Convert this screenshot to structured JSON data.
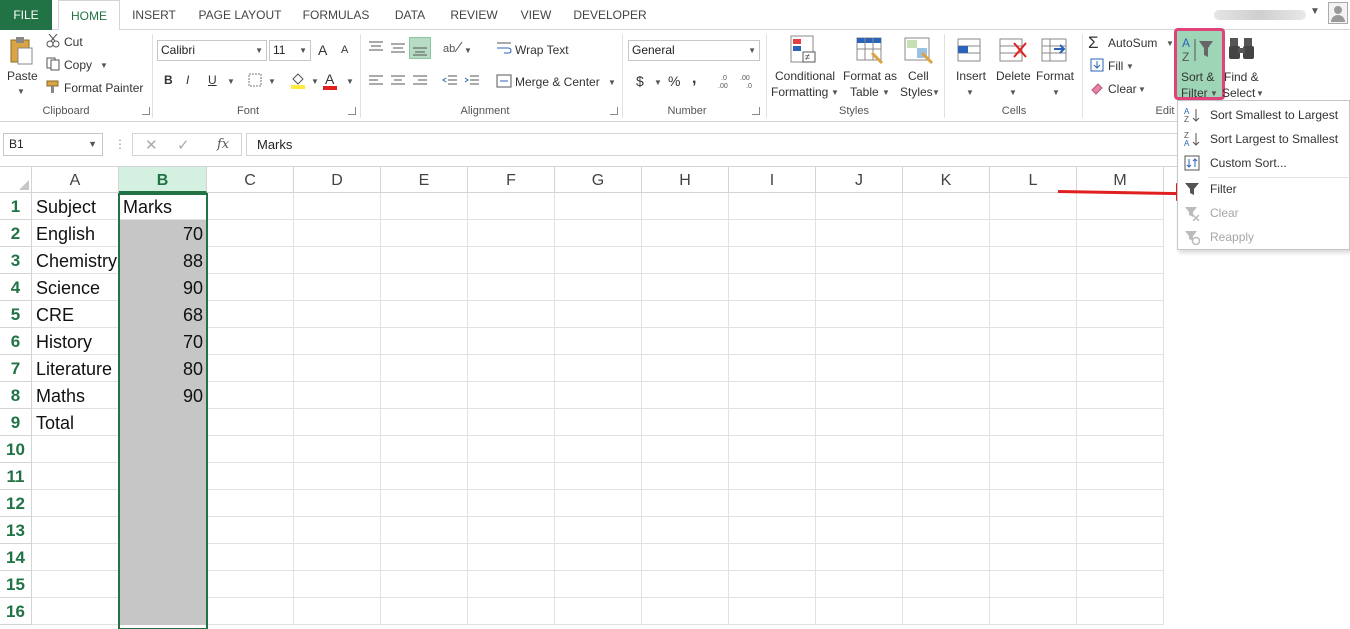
{
  "tabs": [
    "FILE",
    "HOME",
    "INSERT",
    "PAGE LAYOUT",
    "FORMULAS",
    "DATA",
    "REVIEW",
    "VIEW",
    "DEVELOPER"
  ],
  "active_tab": "HOME",
  "clipboard": {
    "paste": "Paste",
    "cut": "Cut",
    "copy": "Copy",
    "format_painter": "Format Painter",
    "group": "Clipboard"
  },
  "font": {
    "name": "Calibri",
    "size": "11",
    "bold": "B",
    "italic": "I",
    "underline": "U",
    "grow": "A",
    "shrink": "A",
    "font_color": "A",
    "group": "Font"
  },
  "alignment": {
    "wrap_text": "Wrap Text",
    "merge_center": "Merge & Center",
    "group": "Alignment"
  },
  "number": {
    "format": "General",
    "currency": "$",
    "percent": "%",
    "comma": ",",
    "inc_decimal": "←.0 .00",
    "dec_decimal": ".00 →.0",
    "group": "Number"
  },
  "styles": {
    "conditional": [
      "Conditional",
      "Formatting"
    ],
    "format_table": [
      "Format as",
      "Table"
    ],
    "cell_styles": [
      "Cell",
      "Styles"
    ],
    "group": "Styles"
  },
  "cells": {
    "insert": "Insert",
    "delete": "Delete",
    "format": "Format",
    "group": "Cells"
  },
  "editing": {
    "autosum": "AutoSum",
    "fill": "Fill",
    "clear": "Clear",
    "sort_filter": [
      "Sort &",
      "Filter"
    ],
    "find_select": [
      "Find &",
      "Select"
    ],
    "group": "Edit"
  },
  "formula_bar": {
    "name_box": "B1",
    "content": "Marks",
    "fx": "fx"
  },
  "columns": [
    "A",
    "B",
    "C",
    "D",
    "E",
    "F",
    "G",
    "H",
    "I",
    "J",
    "K",
    "L",
    "M"
  ],
  "rows": [
    "1",
    "2",
    "3",
    "4",
    "5",
    "6",
    "7",
    "8",
    "9",
    "10",
    "11",
    "12",
    "13",
    "14",
    "15",
    "16"
  ],
  "sheet": [
    [
      "Subject",
      "Marks"
    ],
    [
      "English",
      "70"
    ],
    [
      "Chemistry",
      "88"
    ],
    [
      "Science",
      "90"
    ],
    [
      "CRE",
      "68"
    ],
    [
      "History",
      "70"
    ],
    [
      "Literature",
      "80"
    ],
    [
      "Maths",
      "90"
    ],
    [
      "Total",
      ""
    ]
  ],
  "menu": {
    "sort_asc": "Sort Smallest to Largest",
    "sort_desc": "Sort Largest to Smallest",
    "custom_sort": "Custom Sort...",
    "filter": "Filter",
    "clear": "Clear",
    "reapply": "Reapply"
  },
  "colors": {
    "excel_green": "#217346",
    "highlight": "#e0437a",
    "arrow": "#e0201f"
  }
}
